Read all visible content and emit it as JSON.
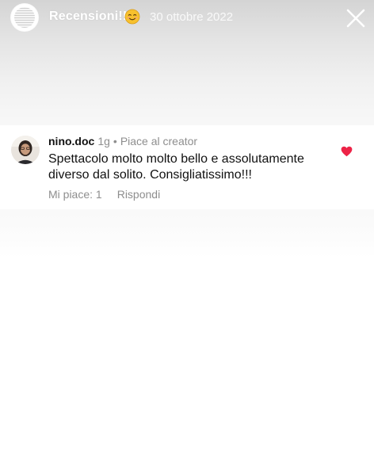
{
  "story": {
    "title": "Recensioni!!!",
    "emoji_icon": "smiling-face-emoji-icon",
    "date": "30 ottobre 2022",
    "close_icon": "close-icon"
  },
  "comment": {
    "username": "nino.doc",
    "age": "1g",
    "separator": "•",
    "creator_like": "Piace al creator",
    "text": "Spettacolo molto molto bello e assolutamente diverso dal solito. Consigliatissimo!!!",
    "likes_label": "Mi piace: 1",
    "reply_label": "Rispondi",
    "heart_icon": "heart-icon",
    "heart_color": "#ed2347"
  }
}
